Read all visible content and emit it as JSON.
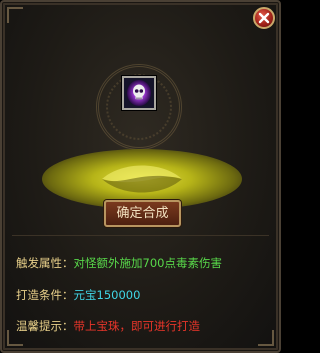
{
  "dialog": {
    "close_icon": "close-icon",
    "item_icon": "purple-skull-orb-icon",
    "confirm_label": "确定合成",
    "attribute_label": "触发属性：",
    "attribute_value": "对怪额外施加700点毒素伤害",
    "condition_label": "打造条件：",
    "condition_value": "元宝150000",
    "tip_label": "温馨提示：",
    "tip_value": "带上宝珠，即可进行打造"
  },
  "colors": {
    "label": "#e7cf89",
    "attribute_value": "#58d84a",
    "condition_value": "#40d6e6",
    "tip_value": "#e8352a",
    "button_bg": "#6a3018"
  }
}
